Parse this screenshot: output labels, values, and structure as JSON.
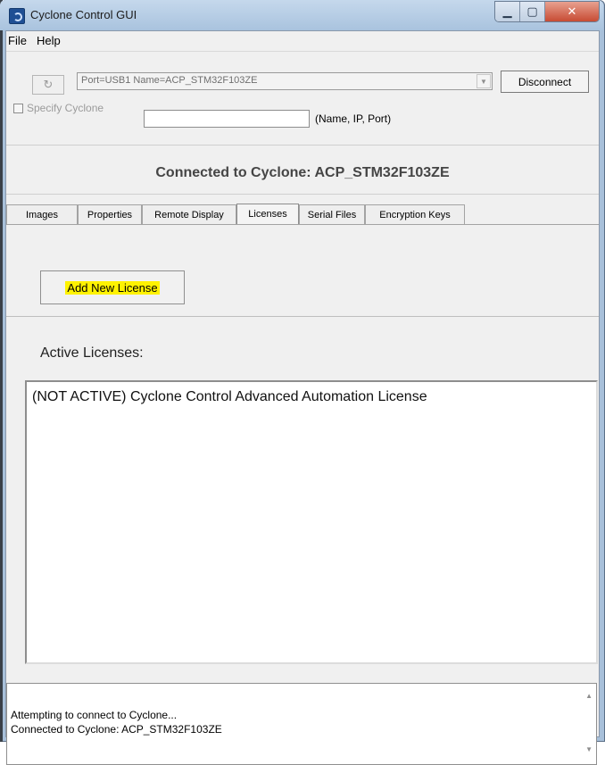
{
  "window": {
    "title": "Cyclone Control GUI"
  },
  "menu": {
    "items": [
      "File",
      "Help"
    ]
  },
  "connection": {
    "port_value": "Port=USB1   Name=ACP_STM32F103ZE",
    "disconnect_label": "Disconnect",
    "specify_label": "Specify Cyclone",
    "specify_value": "",
    "specify_hint": "(Name, IP, Port)",
    "status": "Connected to Cyclone: ACP_STM32F103ZE"
  },
  "tabs": [
    {
      "label": "Images"
    },
    {
      "label": "Properties"
    },
    {
      "label": "Remote Display"
    },
    {
      "label": "Licenses"
    },
    {
      "label": "Serial Files"
    },
    {
      "label": "Encryption Keys"
    }
  ],
  "licenses": {
    "add_button_label": "Add New License",
    "active_label": "Active Licenses:",
    "items": [
      "(NOT ACTIVE) Cyclone Control Advanced Automation License"
    ]
  },
  "log": {
    "lines": [
      "Attempting to connect to Cyclone...",
      "Connected to Cyclone: ACP_STM32F103ZE"
    ]
  }
}
